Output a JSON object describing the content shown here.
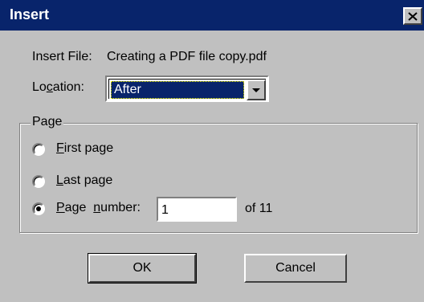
{
  "window": {
    "title": "Insert",
    "close_icon": "close-icon"
  },
  "insert_file": {
    "label": "Insert File:",
    "value": "Creating a PDF file copy.pdf"
  },
  "location": {
    "label_pre": "Lo",
    "label_key": "c",
    "label_post": "ation:",
    "selected": "After",
    "arrow_icon": "chevron-down-icon"
  },
  "page_group": {
    "title": "Page",
    "first_page": {
      "key": "F",
      "rest": "irst page",
      "checked": false
    },
    "last_page": {
      "key": "L",
      "rest": "ast page",
      "checked": false
    },
    "page_number": {
      "key": "P",
      "rest1": "age ",
      "key2": "n",
      "rest2": "umber:",
      "checked": true,
      "value": "1",
      "of_label": "of 11"
    }
  },
  "buttons": {
    "ok_label": "OK",
    "cancel_label": "Cancel"
  }
}
